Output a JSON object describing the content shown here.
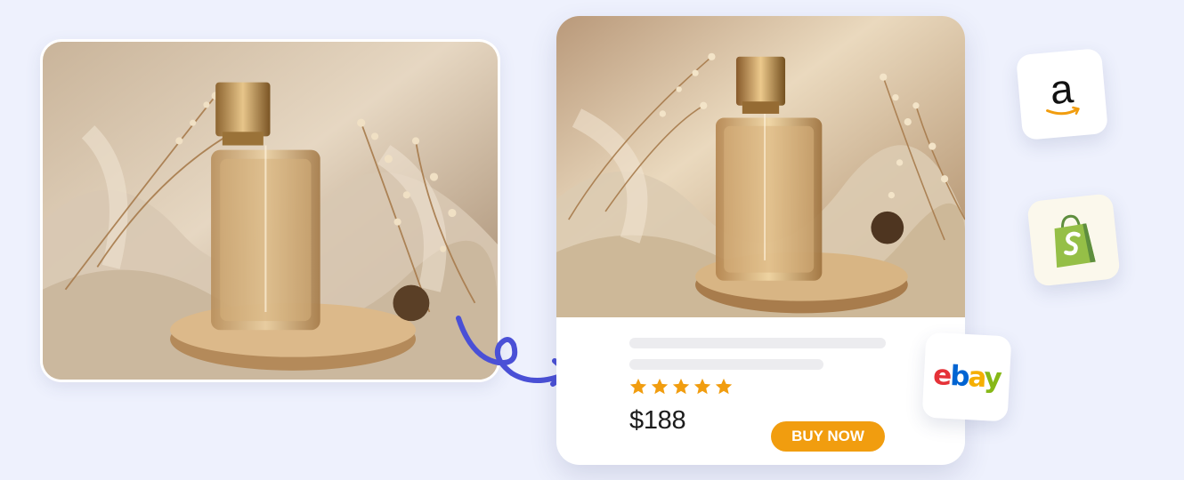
{
  "product": {
    "rating_stars": 5,
    "price": "$188",
    "buy_label": "BUY NOW"
  },
  "marketplaces": {
    "amazon_letter": "a",
    "ebay_letters": [
      "e",
      "b",
      "a",
      "y"
    ]
  },
  "colors": {
    "background": "#eef1fd",
    "star": "#f19d0f",
    "buy_button": "#f19d0f",
    "arrow": "#4a50d6",
    "shopify_green": "#95bf47"
  },
  "icons": {
    "rating": "star-icon",
    "arrow": "curly-arrow-icon",
    "amazon": "amazon-logo-icon",
    "shopify": "shopify-bag-icon",
    "ebay": "ebay-logo-icon"
  }
}
